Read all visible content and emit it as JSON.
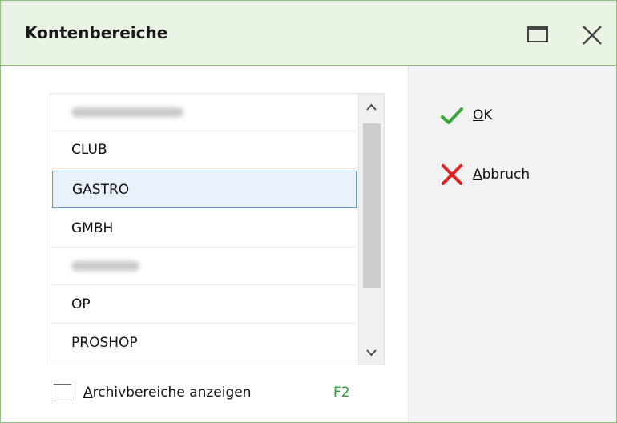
{
  "window": {
    "title": "Kontenbereiche"
  },
  "list": {
    "items": [
      "",
      "CLUB",
      "GASTRO",
      "GMBH",
      "",
      "OP",
      "PROSHOP"
    ],
    "selected": "GASTRO"
  },
  "archive": {
    "label_first": "A",
    "label_rest": "rchivbereiche anzeigen",
    "hotkey": "F2"
  },
  "buttons": {
    "ok": {
      "mnemonic": "O",
      "rest": "K"
    },
    "cancel": {
      "mnemonic": "A",
      "rest": "bbruch"
    }
  },
  "colors": {
    "title_bg": "#eaf4e5",
    "border": "#8fc27f",
    "ok_icon": "#3aa63a",
    "cancel_icon": "#e02020",
    "hotkey": "#2e9e2e",
    "selection_border": "#5b9bd5"
  },
  "icons": {
    "ok": "checkmark-icon",
    "cancel": "x-icon",
    "maximize": "maximize-icon",
    "close": "close-icon"
  }
}
